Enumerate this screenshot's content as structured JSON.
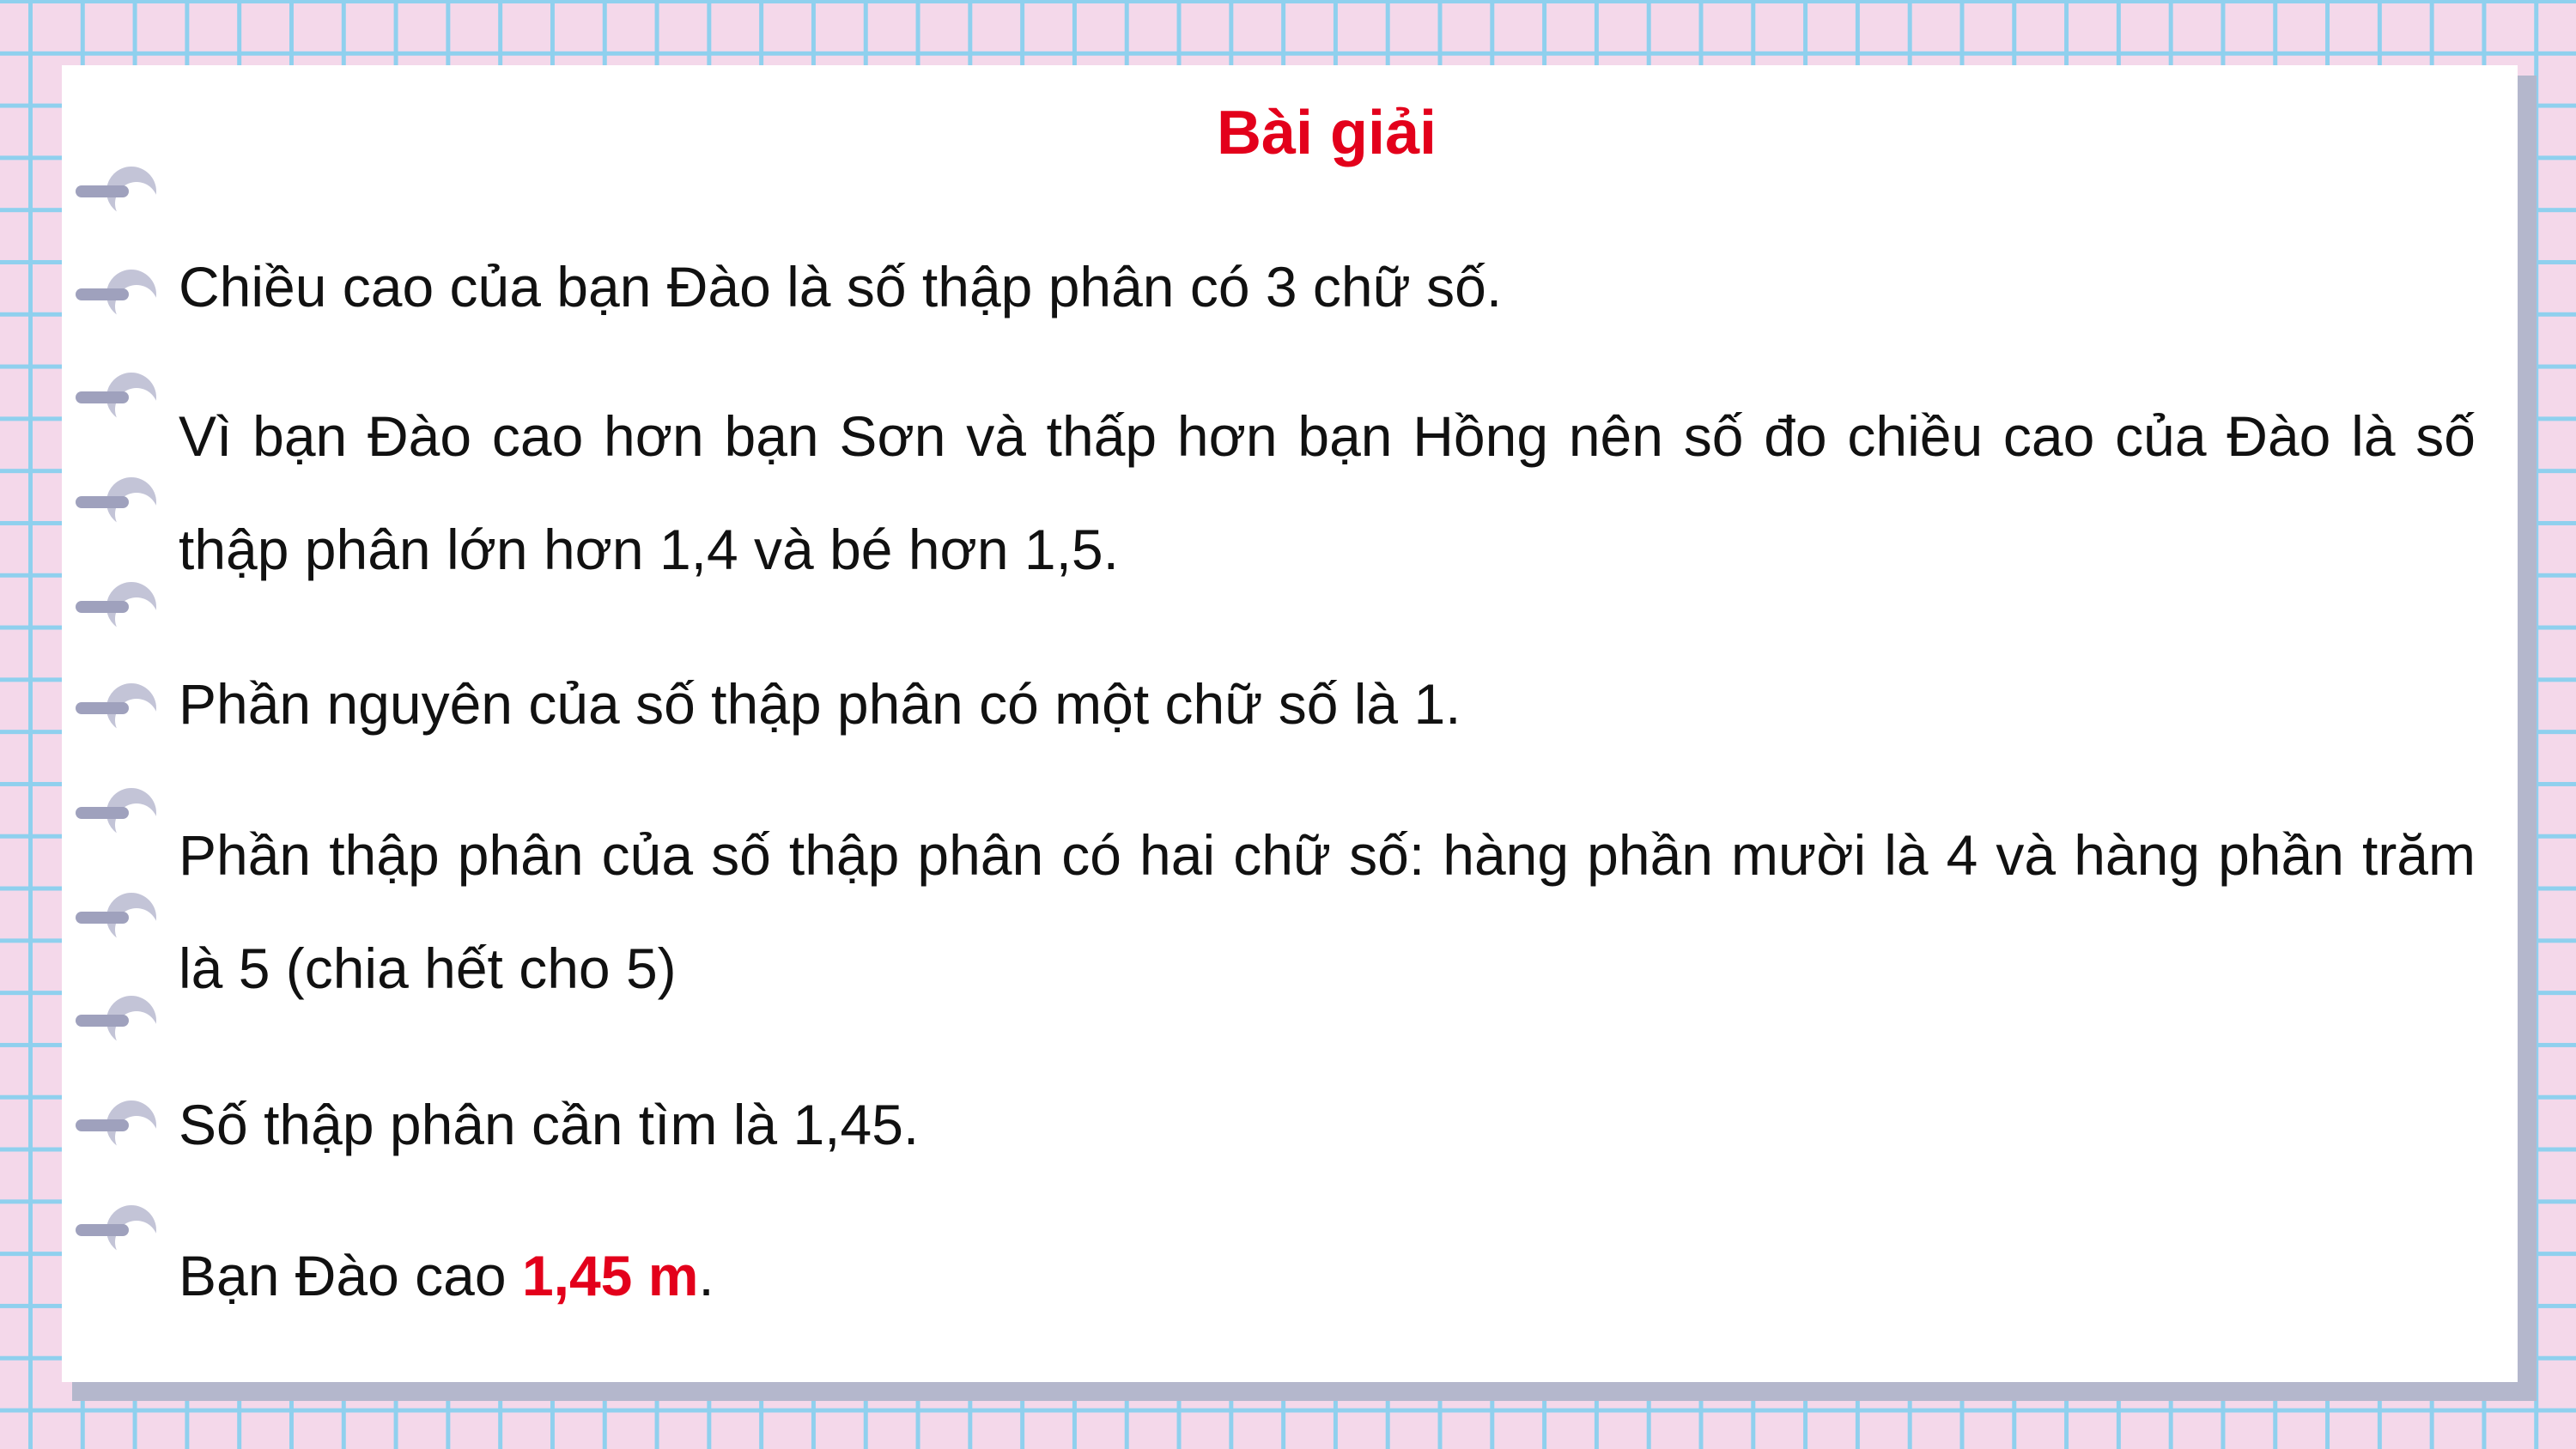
{
  "title": "Bài giải",
  "paragraphs": [
    "Chiều cao của bạn Đào là số thập phân có 3 chữ số.",
    "Vì bạn Đào cao hơn bạn Sơn và thấp hơn bạn Hồng nên số đo chiều cao của Đào là số thập phân lớn hơn 1,4 và bé hơn 1,5.",
    "Phần nguyên của số thập phân có một chữ số là 1.",
    "Phần thập phân của số thập phân có hai chữ số: hàng phần mười là 4 và hàng phần trăm là 5 (chia hết cho 5)",
    "Số thập phân cần tìm là 1,45."
  ],
  "answer": {
    "prefix": "Bạn Đào cao ",
    "value": "1,45 m",
    "suffix": "."
  },
  "colors": {
    "title": "#e3001b",
    "answer_value": "#e3001b",
    "background": "#f4d8ea",
    "grid_line": "#8fd0ee"
  }
}
